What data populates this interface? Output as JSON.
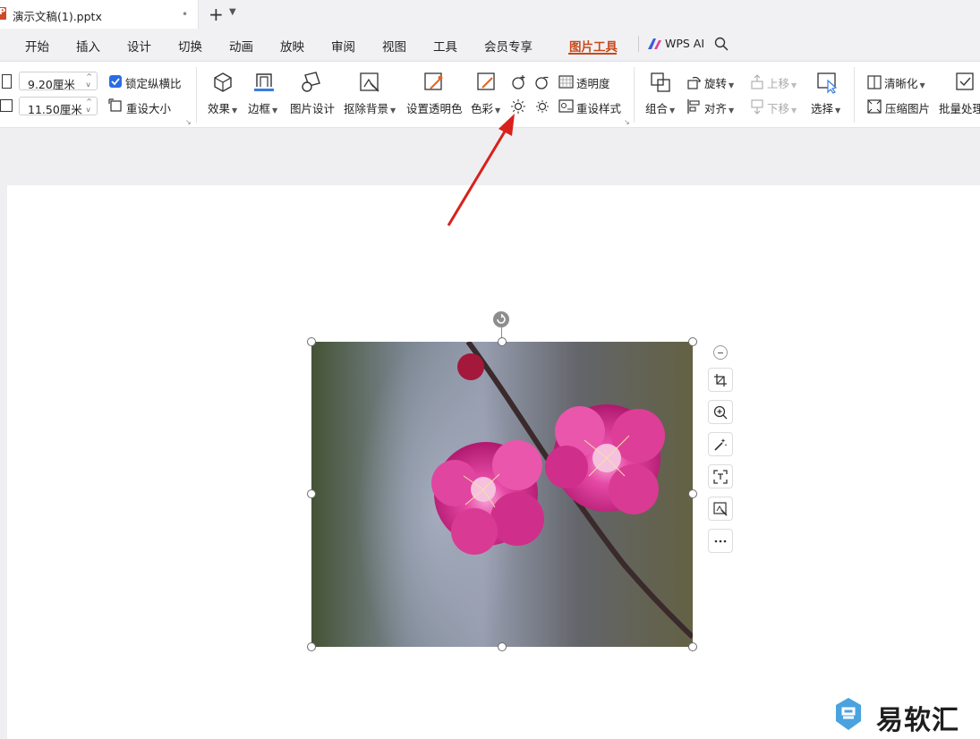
{
  "window": {
    "doc_tab_title": "演示文稿(1).pptx",
    "doc_tab_modified": "•",
    "new_tab": "+",
    "tab_menu": "⌄"
  },
  "menu": {
    "items": [
      "开始",
      "插入",
      "设计",
      "切换",
      "动画",
      "放映",
      "审阅",
      "视图",
      "工具",
      "会员专享",
      "图片工具"
    ],
    "active": "图片工具",
    "wps_ai": "WPS AI",
    "accent_color": "#c74a1a"
  },
  "ribbon": {
    "width_value": "9.20厘米",
    "height_value": "11.50厘米",
    "lock_ratio_label": "锁定纵横比",
    "lock_ratio_checked": true,
    "reset_size_label": "重设大小",
    "effects_label": "效果",
    "border_label": "边框",
    "picture_design_label": "图片设计",
    "remove_bg_label": "抠除背景",
    "set_transparent_color_label": "设置透明色",
    "color_label": "色彩",
    "transparency_label": "透明度",
    "reset_style_label": "重设样式",
    "group_label": "组合",
    "rotate_label": "旋转",
    "align_label": "对齐",
    "move_up_label": "上移",
    "move_down_label": "下移",
    "select_label": "选择",
    "sharpen_label": "清晰化",
    "compress_label": "压缩图片",
    "batch_label": "批量处理"
  },
  "canvas": {
    "float_buttons": [
      "minus-icon",
      "crop-icon",
      "zoom-in-icon",
      "magic-wand-icon",
      "ocr-icon",
      "remove-bg-icon",
      "more-icon"
    ]
  },
  "watermark": {
    "text": "易软汇"
  }
}
